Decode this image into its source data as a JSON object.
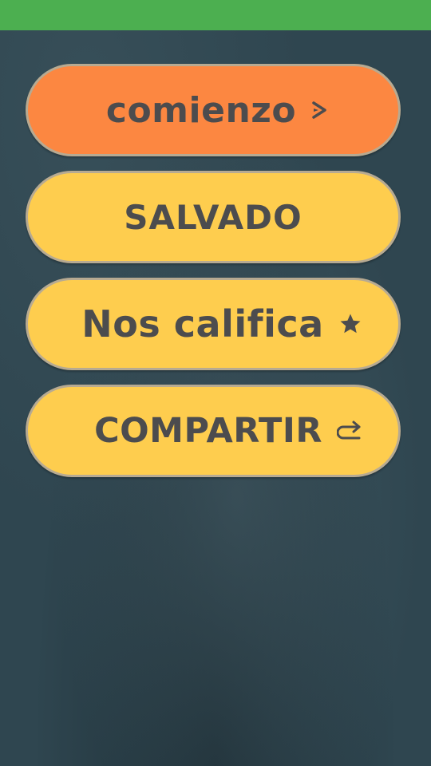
{
  "menu": {
    "start_label": "comienzo",
    "saved_label": "SALVADO",
    "rate_label": "Nos califica",
    "share_label": "COMPARTIR"
  },
  "icons": {
    "start": "play-arrow-icon",
    "rate": "star-icon",
    "share": "share-arrow-icon"
  },
  "colors": {
    "status_bar": "#4caf50",
    "background": "#2f4650",
    "start_button": "#fc8741",
    "menu_button": "#fecd4e",
    "button_text": "#4c4c4e"
  }
}
